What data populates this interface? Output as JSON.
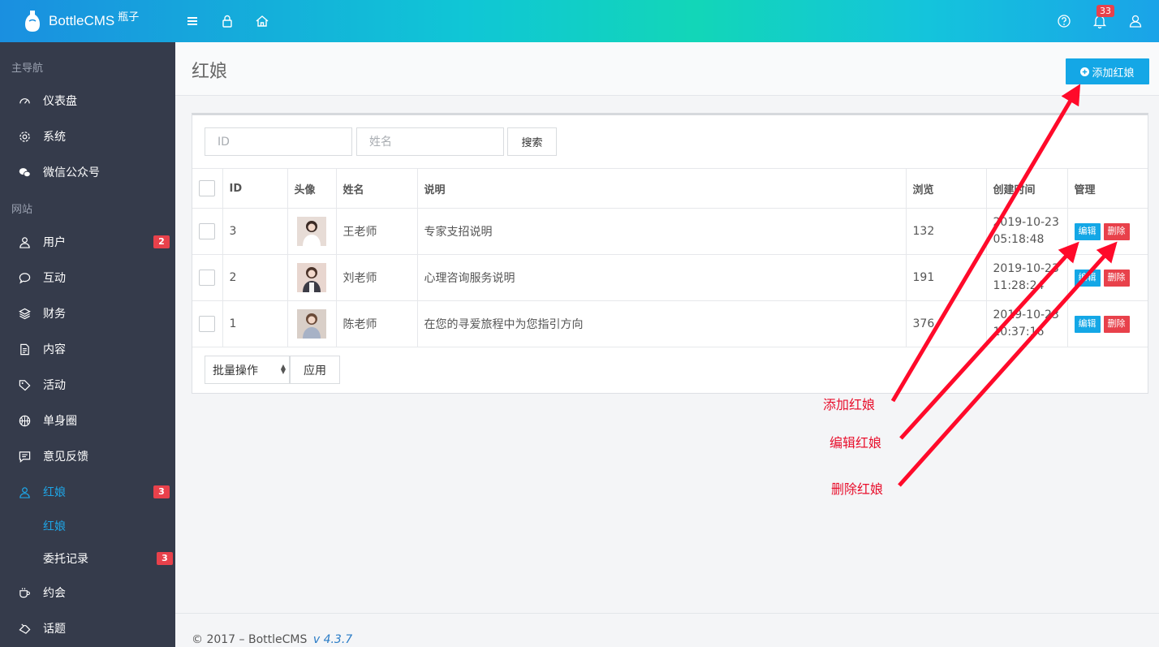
{
  "header": {
    "brand_name": "BottleCMS",
    "brand_sub": "瓶子",
    "bell_count": "33"
  },
  "sidebar": {
    "section_main": "主导航",
    "section_site": "网站",
    "items": [
      {
        "label": "仪表盘",
        "icon": "dashboard-icon"
      },
      {
        "label": "系统",
        "icon": "gear-icon"
      },
      {
        "label": "微信公众号",
        "icon": "wechat-icon"
      },
      {
        "label": "用户",
        "icon": "user-icon",
        "badge": "2"
      },
      {
        "label": "互动",
        "icon": "chat-icon"
      },
      {
        "label": "财务",
        "icon": "layers-icon"
      },
      {
        "label": "内容",
        "icon": "document-icon"
      },
      {
        "label": "活动",
        "icon": "tag-icon"
      },
      {
        "label": "单身圈",
        "icon": "basketball-icon"
      },
      {
        "label": "意见反馈",
        "icon": "message-icon"
      },
      {
        "label": "红娘",
        "icon": "user-icon",
        "badge": "3",
        "active": true
      },
      {
        "label": "约会",
        "icon": "coffee-icon"
      },
      {
        "label": "话题",
        "icon": "gift-icon"
      }
    ],
    "subitems": [
      {
        "label": "红娘",
        "active": true
      },
      {
        "label": "委托记录",
        "badge": "3"
      }
    ]
  },
  "page": {
    "title": "红娘",
    "add_button": "添加红娘"
  },
  "search": {
    "id_placeholder": "ID",
    "name_placeholder": "姓名",
    "button": "搜索"
  },
  "table": {
    "headers": [
      "ID",
      "头像",
      "姓名",
      "说明",
      "浏览",
      "创建时间",
      "管理"
    ],
    "rows": [
      {
        "id": "3",
        "name": "王老师",
        "desc": "专家支招说明",
        "views": "132",
        "created_date": "2019-10-23",
        "created_time": "05:18:48"
      },
      {
        "id": "2",
        "name": "刘老师",
        "desc": "心理咨询服务说明",
        "views": "191",
        "created_date": "2019-10-23",
        "created_time": "11:28:24"
      },
      {
        "id": "1",
        "name": "陈老师",
        "desc": "在您的寻爱旅程中为您指引方向",
        "views": "376",
        "created_date": "2019-10-23",
        "created_time": "10:37:16"
      }
    ],
    "edit_label": "编辑",
    "delete_label": "删除"
  },
  "bulk": {
    "select_value": "批量操作",
    "apply": "应用"
  },
  "footer": {
    "text": "© 2017 – BottleCMS",
    "version": "v 4.3.7"
  },
  "annotations": {
    "add": "添加红娘",
    "edit": "编辑红娘",
    "delete": "删除红娘",
    "color": "#ff0a2a"
  },
  "colors": {
    "accent": "#14a7e6",
    "danger": "#e8414b",
    "sidebar_bg": "#353b4b"
  }
}
